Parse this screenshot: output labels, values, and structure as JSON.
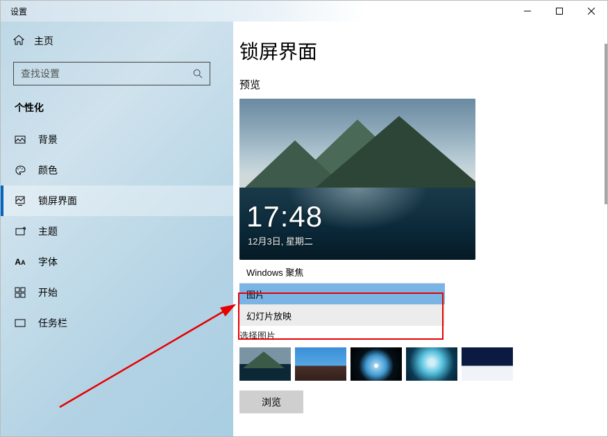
{
  "window": {
    "title": "设置"
  },
  "sidebar": {
    "home": "主页",
    "search_placeholder": "查找设置",
    "category": "个性化",
    "items": [
      {
        "label": "背景"
      },
      {
        "label": "颜色"
      },
      {
        "label": "锁屏界面"
      },
      {
        "label": "主题"
      },
      {
        "label": "字体"
      },
      {
        "label": "开始"
      },
      {
        "label": "任务栏"
      }
    ]
  },
  "content": {
    "page_title": "锁屏界面",
    "preview_label": "预览",
    "clock": "17:48",
    "date": "12月3日, 星期二",
    "dropdown": {
      "options": [
        "Windows 聚焦",
        "图片",
        "幻灯片放映"
      ],
      "selected": "图片"
    },
    "choose_label": "选择图片",
    "browse": "浏览"
  }
}
